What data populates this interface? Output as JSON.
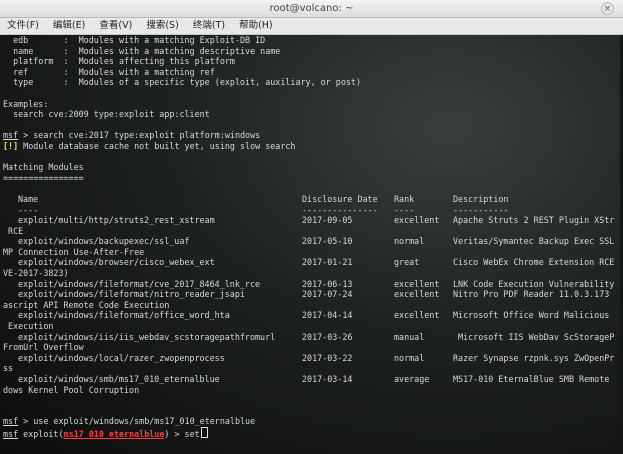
{
  "window": {
    "title": "root@volcano: ~",
    "close": "×"
  },
  "menu": [
    "文件(F)",
    "编辑(E)",
    "查看(V)",
    "搜索(S)",
    "终端(T)",
    "帮助(H)"
  ],
  "help_lines": [
    "  edb       :  Modules with a matching Exploit-DB ID",
    "  name      :  Modules with a matching descriptive name",
    "  platform  :  Modules affecting this platform",
    "  ref       :  Modules with a matching ref",
    "  type      :  Modules of a specific type (exploit, auxiliary, or post)"
  ],
  "examples_header": "Examples:",
  "examples_line": "  search cve:2009 type:exploit app:client",
  "prompt": "msf",
  "search_cmd": " > search cve:2017 type:exploit platform:windows",
  "warn_tag": "[!]",
  "warn_text": " Module database cache not built yet, using slow search",
  "matching_header": "Matching Modules",
  "matching_rule": "================",
  "columns": {
    "name": "Name",
    "date": "Disclosure Date",
    "rank": "Rank",
    "desc": "Description"
  },
  "dashes": {
    "name": "----",
    "date": "---------------",
    "rank": "----",
    "desc": "-----------"
  },
  "modules": [
    {
      "name": "exploit/multi/http/struts2_rest_xstream",
      "date": "2017-09-05",
      "rank": "excellent",
      "desc": "Apache Struts 2 REST Plugin XStr",
      "wrap": " RCE"
    },
    {
      "name": "exploit/windows/backupexec/ssl_uaf",
      "date": "2017-05-10",
      "rank": "normal",
      "desc": "Veritas/Symantec Backup Exec SSL",
      "wrap": "MP Connection Use-After-Free"
    },
    {
      "name": "exploit/windows/browser/cisco_webex_ext",
      "date": "2017-01-21",
      "rank": "great",
      "desc": "Cisco WebEx Chrome Extension RCE",
      "wrap": "VE-2017-3823)"
    },
    {
      "name": "exploit/windows/fileformat/cve_2017_8464_lnk_rce",
      "date": "2017-06-13",
      "rank": "excellent",
      "desc": "LNK Code Execution Vulnerability",
      "wrap": ""
    },
    {
      "name": "exploit/windows/fileformat/nitro_reader_jsapi",
      "date": "2017-07-24",
      "rank": "excellent",
      "desc": "Nitro Pro PDF Reader 11.0.3.173",
      "wrap": "ascript API Remote Code Execution"
    },
    {
      "name": "exploit/windows/fileformat/office_word_hta",
      "date": "2017-04-14",
      "rank": "excellent",
      "desc": "Microsoft Office Word Malicious",
      "wrap": " Execution"
    },
    {
      "name": "exploit/windows/iis/iis_webdav_scstoragepathfromurl",
      "date": "2017-03-26",
      "rank": "manual",
      "desc": " Microsoft IIS WebDav ScStorageP",
      "wrap": "FromUrl Overflow"
    },
    {
      "name": "exploit/windows/local/razer_zwopenprocess",
      "date": "2017-03-22",
      "rank": "normal",
      "desc": "Razer Synapse rzpnk.sys ZwOpenPr",
      "wrap": "ss"
    },
    {
      "name": "exploit/windows/smb/ms17_010_eternalblue",
      "date": "2017-03-14",
      "rank": "average",
      "desc": "MS17-010 EternalBlue SMB Remote",
      "wrap": "dows Kernel Pool Corruption"
    }
  ],
  "use_cmd": " > use exploit/windows/smb/ms17_010_eternalblue",
  "exploit_prefix": " exploit(",
  "exploit_name": "ms17_010_eternalblue",
  "exploit_suffix": ") > ",
  "typed": "set"
}
